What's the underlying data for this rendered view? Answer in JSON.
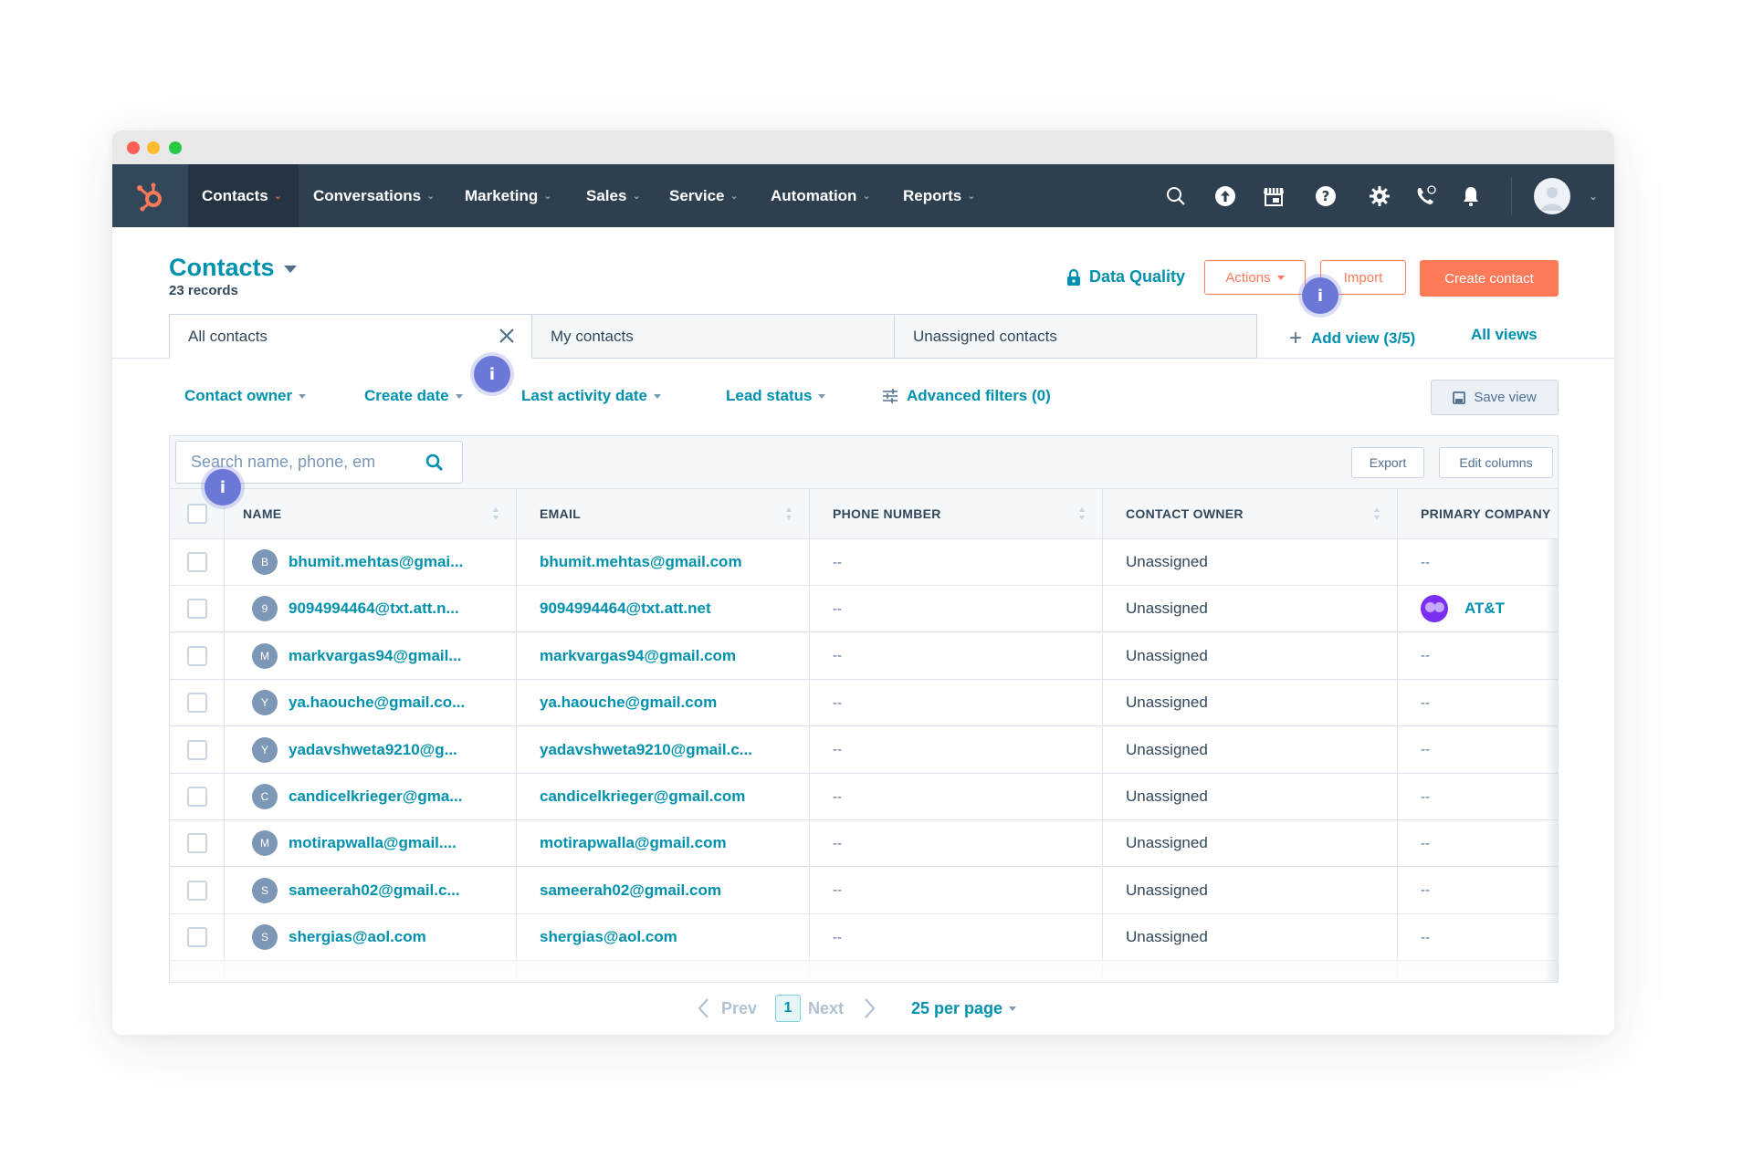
{
  "window": {
    "traffic_lights": {
      "close": "#ff5f57",
      "minimize": "#febc2e",
      "maximize": "#28c840"
    }
  },
  "nav": {
    "logo": "hubspot-sprocket",
    "items": [
      {
        "label": "Contacts",
        "active": true
      },
      {
        "label": "Conversations"
      },
      {
        "label": "Marketing"
      },
      {
        "label": "Sales"
      },
      {
        "label": "Service"
      },
      {
        "label": "Automation"
      },
      {
        "label": "Reports"
      }
    ],
    "icons": [
      "search-icon",
      "upgrade-icon",
      "marketplace-icon",
      "help-icon",
      "settings-icon",
      "calling-icon",
      "notifications-icon"
    ],
    "chevron": "⌄"
  },
  "header": {
    "title": "Contacts",
    "records": "23 records",
    "data_quality": "Data Quality",
    "actions": "Actions",
    "import": "Import",
    "create": "Create contact"
  },
  "tabs": [
    {
      "label": "All contacts",
      "active": true,
      "closable": true
    },
    {
      "label": "My contacts"
    },
    {
      "label": "Unassigned contacts"
    }
  ],
  "add_view": "Add view (3/5)",
  "all_views": "All views",
  "filters": {
    "contact_owner": "Contact owner",
    "create_date": "Create date",
    "last_activity": "Last activity date",
    "lead_status": "Lead status",
    "advanced": "Advanced filters (0)",
    "save_view": "Save view"
  },
  "table": {
    "search_placeholder": "Search name, phone, em",
    "export": "Export",
    "edit_columns": "Edit columns",
    "columns": [
      "NAME",
      "EMAIL",
      "PHONE NUMBER",
      "CONTACT OWNER",
      "PRIMARY COMPANY"
    ],
    "rows": [
      {
        "initial": "B",
        "name": "bhumit.mehtas@gmai...",
        "email": "bhumit.mehtas@gmail.com",
        "phone": "--",
        "owner": "Unassigned",
        "company": "--"
      },
      {
        "initial": "9",
        "name": "9094994464@txt.att.n...",
        "email": "9094994464@txt.att.net",
        "phone": "--",
        "owner": "Unassigned",
        "company": "AT&T"
      },
      {
        "initial": "M",
        "name": "markvargas94@gmail...",
        "email": "markvargas94@gmail.com",
        "phone": "--",
        "owner": "Unassigned",
        "company": "--"
      },
      {
        "initial": "Y",
        "name": "ya.haouche@gmail.co...",
        "email": "ya.haouche@gmail.com",
        "phone": "--",
        "owner": "Unassigned",
        "company": "--"
      },
      {
        "initial": "Y",
        "name": "yadavshweta9210@g...",
        "email": "yadavshweta9210@gmail.c...",
        "phone": "--",
        "owner": "Unassigned",
        "company": "--"
      },
      {
        "initial": "C",
        "name": "candicelkrieger@gma...",
        "email": "candicelkrieger@gmail.com",
        "phone": "--",
        "owner": "Unassigned",
        "company": "--"
      },
      {
        "initial": "M",
        "name": "motirapwalla@gmail....",
        "email": "motirapwalla@gmail.com",
        "phone": "--",
        "owner": "Unassigned",
        "company": "--"
      },
      {
        "initial": "S",
        "name": "sameerah02@gmail.c...",
        "email": "sameerah02@gmail.com",
        "phone": "--",
        "owner": "Unassigned",
        "company": "--"
      },
      {
        "initial": "S",
        "name": "shergias@aol.com",
        "email": "shergias@aol.com",
        "phone": "--",
        "owner": "Unassigned",
        "company": "--"
      }
    ]
  },
  "pagination": {
    "prev": "Prev",
    "page": "1",
    "next": "Next",
    "per_page": "25 per page"
  },
  "info_badge": "i",
  "colors": {
    "nav_bg": "#2e3f50",
    "accent_teal": "#0091ae",
    "accent_orange": "#ff7a59",
    "info_badge": "#6b78d8"
  }
}
